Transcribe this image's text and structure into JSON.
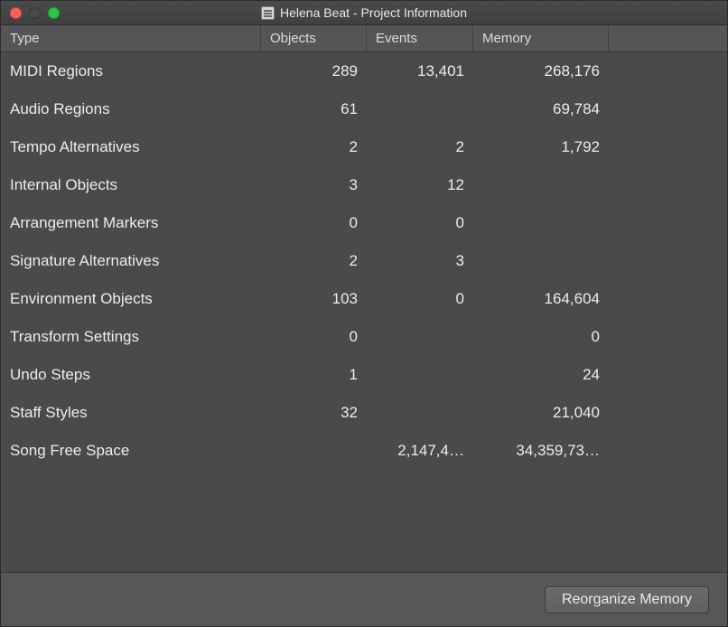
{
  "window": {
    "title": "Helena Beat - Project Information"
  },
  "columns": {
    "type": "Type",
    "objects": "Objects",
    "events": "Events",
    "memory": "Memory"
  },
  "rows": [
    {
      "type": "MIDI Regions",
      "objects": "289",
      "events": "13,401",
      "memory": "268,176"
    },
    {
      "type": "Audio Regions",
      "objects": "61",
      "events": "",
      "memory": "69,784"
    },
    {
      "type": "Tempo Alternatives",
      "objects": "2",
      "events": "2",
      "memory": "1,792"
    },
    {
      "type": "Internal Objects",
      "objects": "3",
      "events": "12",
      "memory": ""
    },
    {
      "type": "Arrangement Markers",
      "objects": "0",
      "events": "0",
      "memory": ""
    },
    {
      "type": "Signature Alternatives",
      "objects": "2",
      "events": "3",
      "memory": ""
    },
    {
      "type": "Environment Objects",
      "objects": "103",
      "events": "0",
      "memory": "164,604"
    },
    {
      "type": "Transform Settings",
      "objects": "0",
      "events": "",
      "memory": "0"
    },
    {
      "type": "Undo Steps",
      "objects": "1",
      "events": "",
      "memory": "24"
    },
    {
      "type": "Staff Styles",
      "objects": "32",
      "events": "",
      "memory": "21,040"
    },
    {
      "type": "Song Free Space",
      "objects": "",
      "events": "2,147,4…",
      "memory": "34,359,73…"
    }
  ],
  "footer": {
    "reorganize_label": "Reorganize Memory"
  }
}
